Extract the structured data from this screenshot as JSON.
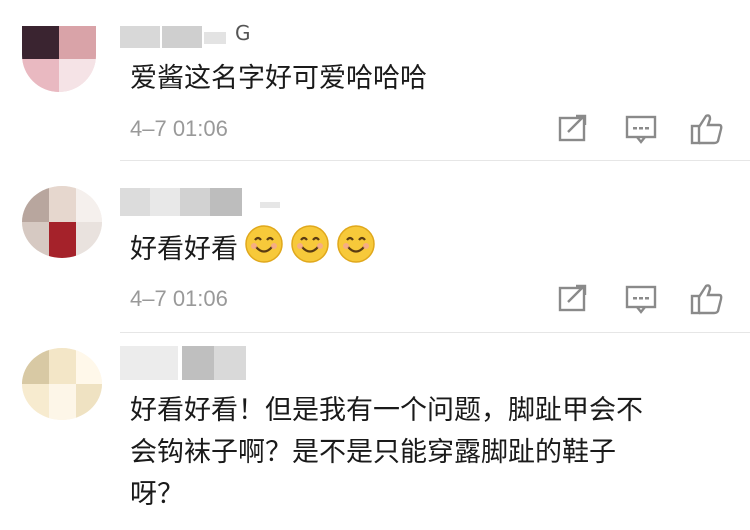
{
  "comments": [
    {
      "name_suffix": "G",
      "text": "爱酱这名字好可爱哈哈哈",
      "time": "4–7 01:06",
      "emojis": []
    },
    {
      "name_suffix": "",
      "text": "好看好看",
      "time": "4–7 01:06",
      "emojis": [
        "smiling-face",
        "smiling-face",
        "smiling-face"
      ]
    },
    {
      "name_suffix": "",
      "text_lines": [
        "好看好看！但是我有一个问题，脚趾甲会不",
        "会钩袜子啊？是不是只能穿露脚趾的鞋子",
        "呀？"
      ]
    }
  ],
  "icons": {
    "share": "share-icon",
    "comment": "comment-icon",
    "like": "like-icon"
  },
  "colors": {
    "time": "#999999",
    "icon": "#8a8a8a",
    "divider": "#e6e6e6",
    "emoji": "#f7c93a"
  }
}
